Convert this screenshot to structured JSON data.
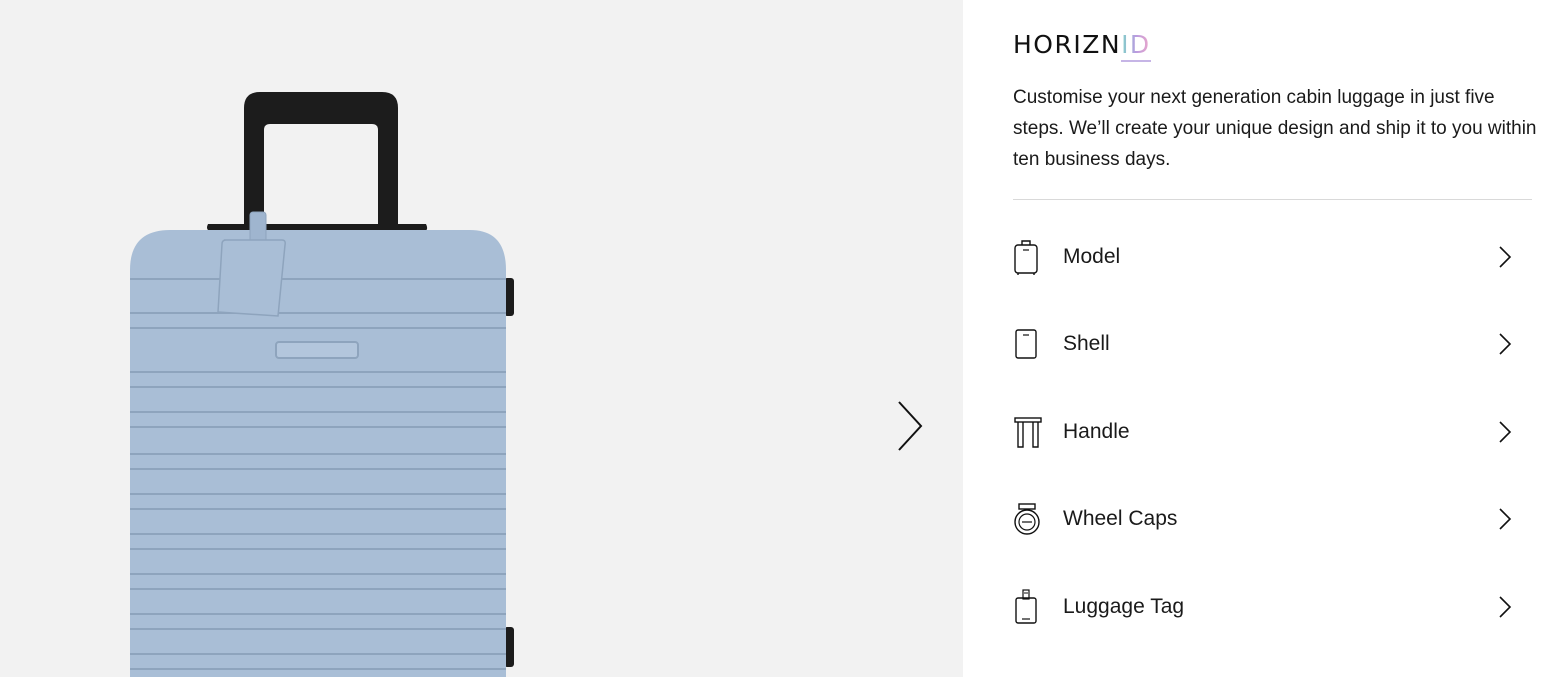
{
  "brand": {
    "logo_main": "HORIZN",
    "logo_suffix": "ID"
  },
  "intro": "Customise your next generation cabin luggage in just five steps. We’ll create your unique design and ship it to you within ten business days.",
  "product": {
    "shell_color": "#a9bed6",
    "handle_color": "#1c1c1c",
    "stage_background": "#f2f2f2"
  },
  "steps": [
    {
      "label": "Model",
      "icon": "suitcase-icon"
    },
    {
      "label": "Shell",
      "icon": "shell-icon"
    },
    {
      "label": "Handle",
      "icon": "handle-icon"
    },
    {
      "label": "Wheel Caps",
      "icon": "wheel-cap-icon"
    },
    {
      "label": "Luggage Tag",
      "icon": "luggage-tag-icon"
    }
  ]
}
